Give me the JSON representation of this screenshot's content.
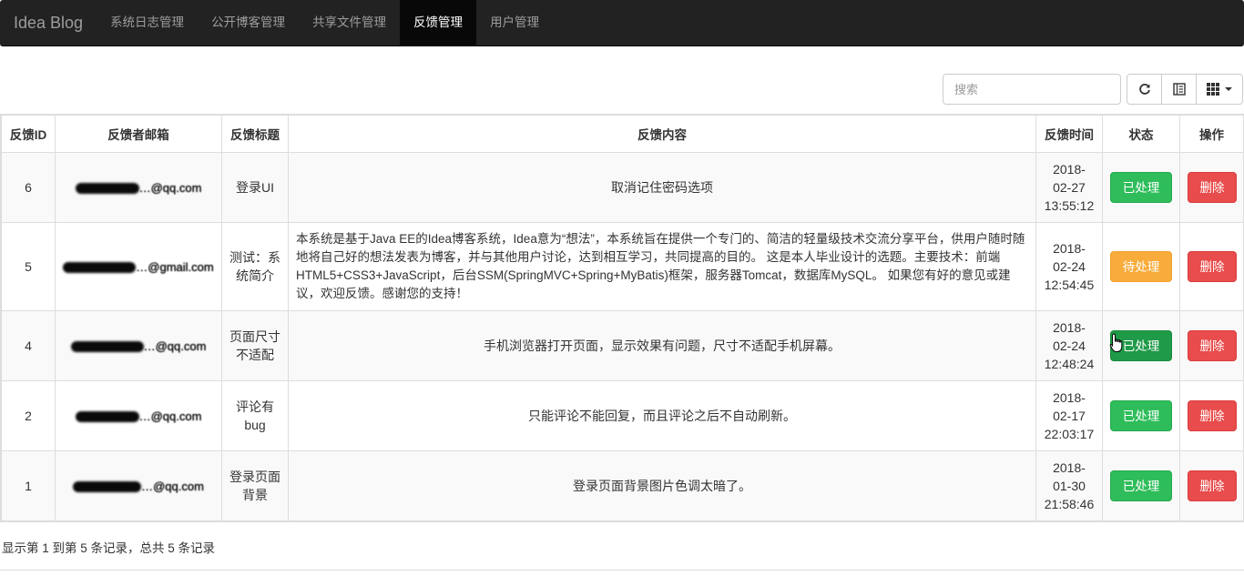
{
  "navbar": {
    "brand": "Idea Blog",
    "items": [
      {
        "label": "系统日志管理"
      },
      {
        "label": "公开博客管理"
      },
      {
        "label": "共享文件管理"
      },
      {
        "label": "反馈管理"
      },
      {
        "label": "用户管理"
      }
    ],
    "active_item": "反馈管理"
  },
  "toolbar": {
    "search_placeholder": "搜索",
    "buttons": [
      "refresh-icon",
      "toggle-view-icon",
      "columns-icon"
    ]
  },
  "table": {
    "headers": [
      "反馈ID",
      "反馈者邮箱",
      "反馈标题",
      "反馈内容",
      "反馈时间",
      "状态",
      "操作"
    ],
    "rows": [
      {
        "id": "6",
        "email": "…@qq.com",
        "title": "登录UI",
        "content": "取消记住密码选项",
        "time_date": "2018-",
        "time_md": "02-27",
        "time_hms": "13:55:12",
        "status": "已处理",
        "action": "删除"
      },
      {
        "id": "5",
        "email": "…@gmail.com",
        "title": "测试：系统简介",
        "content": "本系统是基于Java EE的Idea博客系统，Idea意为“想法”，本系统旨在提供一个专门的、简洁的轻量级技术交流分享平台，供用户随时随地将自己好的想法发表为博客，并与其他用户讨论，达到相互学习，共同提高的目的。 这是本人毕业设计的选题。主要技术：前端HTML5+CSS3+JavaScript，后台SSM(SpringMVC+Spring+MyBatis)框架，服务器Tomcat，数据库MySQL。 如果您有好的意见或建议，欢迎反馈。感谢您的支持！",
        "time_date": "2018-",
        "time_md": "02-24",
        "time_hms": "12:54:45",
        "status": "待处理",
        "action": "删除"
      },
      {
        "id": "4",
        "email": "…@qq.com",
        "title": "页面尺寸不适配",
        "content": "手机浏览器打开页面，显示效果有问题，尺寸不适配手机屏幕。",
        "time_date": "2018-",
        "time_md": "02-24",
        "time_hms": "12:48:24",
        "status": "已处理",
        "action": "删除"
      },
      {
        "id": "2",
        "email": "…@qq.com",
        "title": "评论有bug",
        "content": "只能评论不能回复，而且评论之后不自动刷新。",
        "time_date": "2018-",
        "time_md": "02-17",
        "time_hms": "22:03:17",
        "status": "已处理",
        "action": "删除"
      },
      {
        "id": "1",
        "email": "…@qq.com",
        "title": "登录页面背景",
        "content": "登录页面背景图片色调太暗了。",
        "time_date": "2018-",
        "time_md": "01-30",
        "time_hms": "21:58:46",
        "status": "已处理",
        "action": "删除"
      }
    ]
  },
  "footer": {
    "summary": "显示第 1 到第 5 条记录，总共 5 条记录"
  },
  "colors": {
    "navbar_bg": "#222222",
    "processed": "#2ebd5a",
    "pending": "#f8ac3b",
    "delete": "#e84c4c"
  }
}
